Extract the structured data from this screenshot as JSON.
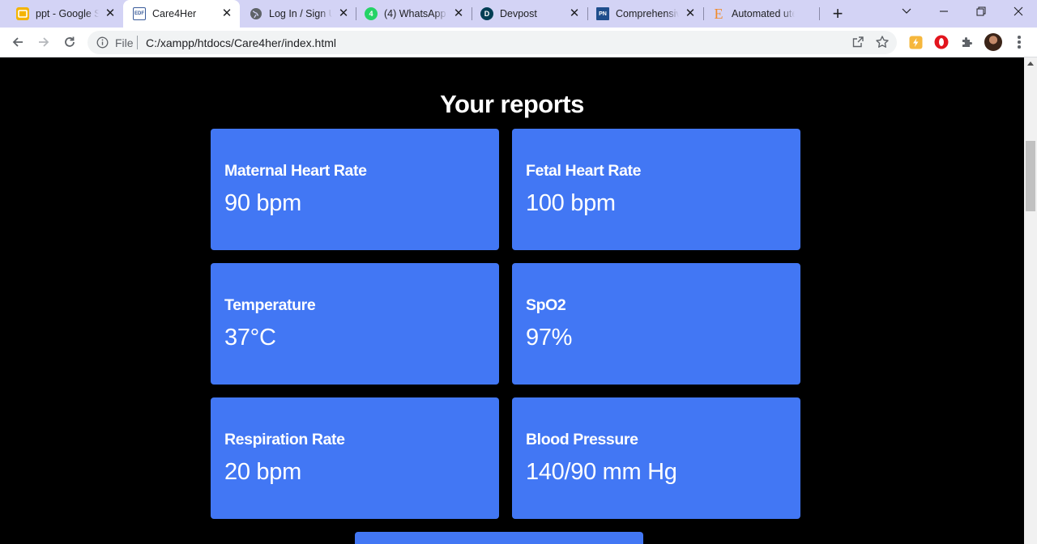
{
  "browser": {
    "tabs": [
      {
        "title": "ppt - Google Sl",
        "favicon": "google-slides-icon",
        "color": "#f4b400",
        "active": false
      },
      {
        "title": "Care4Her",
        "favicon": "pdf-document-icon",
        "color": "#3a5c9a",
        "active": true
      },
      {
        "title": "Log In / Sign Up",
        "favicon": "globe-icon",
        "color": "#5f6368",
        "active": false
      },
      {
        "title": "(4) WhatsApp",
        "favicon": "whatsapp-icon",
        "color": "#25d366",
        "active": false,
        "badge": "4"
      },
      {
        "title": "Devpost",
        "favicon": "devpost-icon",
        "color": "#003e54",
        "active": false,
        "glyph": "D"
      },
      {
        "title": "Comprehensive",
        "favicon": "journal-logo-icon",
        "color": "#1f4e8c",
        "active": false,
        "glyph": "PN"
      },
      {
        "title": "Automated ute",
        "favicon": "elsevier-logo-icon",
        "color": "#f08a2a",
        "active": false,
        "glyph": "E"
      }
    ],
    "new_tab_glyph": "+",
    "tab_close_glyph": "✕",
    "window_controls": {
      "dropdown": "⌵",
      "minimize": "—",
      "maximize": "❐",
      "close": "✕"
    },
    "address": {
      "scheme": "File",
      "url": "C:/xampp/htdocs/Care4her/index.html"
    }
  },
  "page": {
    "title": "Your reports",
    "reports": [
      {
        "label": "Maternal Heart Rate",
        "value": "90 bpm"
      },
      {
        "label": "Fetal Heart Rate",
        "value": "100 bpm"
      },
      {
        "label": "Temperature",
        "value": "37°C"
      },
      {
        "label": "SpO2",
        "value": "97%"
      },
      {
        "label": "Respiration Rate",
        "value": "20 bpm"
      },
      {
        "label": "Blood Pressure",
        "value": "140/90 mm Hg"
      }
    ],
    "accent_color": "#4277f4",
    "background_color": "#000000"
  }
}
